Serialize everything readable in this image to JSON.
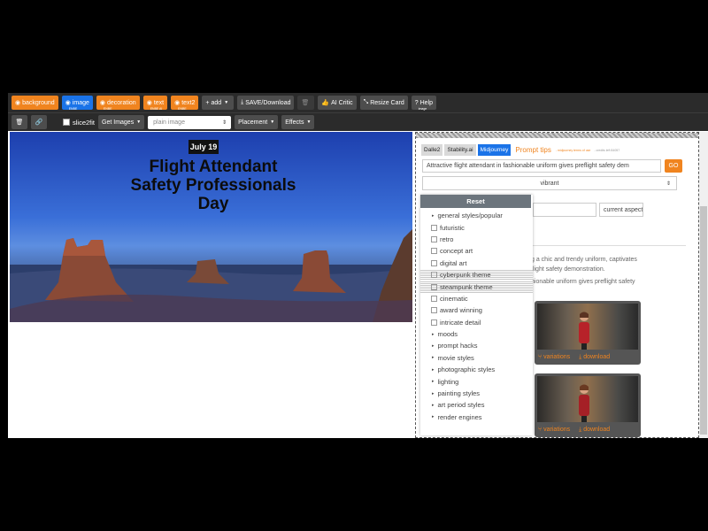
{
  "toolbar": {
    "background_label": "background",
    "image_label": "image",
    "image_sub": "ENBE",
    "decoration_label": "decoration",
    "decoration_sub": "ENBE",
    "text_label": "text",
    "text_sub": "ENBE AI",
    "text2_label": "text2",
    "text2_sub": "ENBE",
    "add_label": "add",
    "save_label": "SAVE/Download",
    "ai_critic_label": "AI Critic",
    "resize_label": "Resize Card",
    "help_label": "Help",
    "help_sub": "image"
  },
  "toolbar2": {
    "slice_label": "slice2fit",
    "get_images_label": "Get Images",
    "image_type_value": "plain image",
    "placement_label": "Placement",
    "effects_label": "Effects"
  },
  "banner": {
    "date": "July 19",
    "title_line1": "Flight Attendant",
    "title_line2": "Safety Professionals",
    "title_line3": "Day"
  },
  "panel": {
    "tabs": [
      "Dalle2",
      "Stability.ai",
      "Midjourney"
    ],
    "active_tab": "Midjourney",
    "prompt_tips": "Prompt tips",
    "terms": "- midjourney terms of use",
    "credits": "- credits left 84057",
    "prompt_value": "Attractive flight attendant in fashionable uniform gives preflight safety dem",
    "go_label": "GO",
    "style_value": "vibrant",
    "aspect_value": "current aspect",
    "desc_line1": "g a chic and trendy uniform, captivates",
    "desc_line2": "flight safety demonstration.",
    "desc_line3": "hionable uniform gives preflight safety",
    "variations_label": "variations",
    "download_label": "download"
  },
  "dropdown": {
    "reset_label": "Reset",
    "items": [
      {
        "type": "group",
        "label": "general styles/popular"
      },
      {
        "type": "check",
        "label": "futuristic"
      },
      {
        "type": "check",
        "label": "retro"
      },
      {
        "type": "check",
        "label": "concept art"
      },
      {
        "type": "check",
        "label": "digital art"
      },
      {
        "type": "check",
        "label": "cyberpunk theme"
      },
      {
        "type": "check",
        "label": "steampunk theme"
      },
      {
        "type": "check",
        "label": "cinematic"
      },
      {
        "type": "check",
        "label": "award winning"
      },
      {
        "type": "check",
        "label": "intricate detail"
      },
      {
        "type": "group",
        "label": "moods"
      },
      {
        "type": "group",
        "label": "prompt hacks"
      },
      {
        "type": "group",
        "label": "movie styles"
      },
      {
        "type": "group",
        "label": "photographic styles"
      },
      {
        "type": "group",
        "label": "lighting"
      },
      {
        "type": "group",
        "label": "painting styles"
      },
      {
        "type": "group",
        "label": "art period styles"
      },
      {
        "type": "group",
        "label": "render engines"
      }
    ]
  },
  "colors": {
    "accent_orange": "#f0841f",
    "accent_blue": "#1a73e8",
    "toolbar_bg": "#2b2b2b"
  }
}
